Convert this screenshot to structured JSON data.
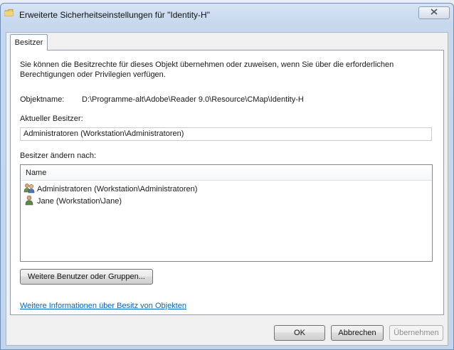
{
  "window": {
    "title": "Erweiterte Sicherheitseinstellungen für \"Identity-H\"",
    "icon": "folder-icon"
  },
  "tabs": [
    {
      "label": "Besitzer",
      "selected": true
    }
  ],
  "panel": {
    "intro_text": "Sie können die Besitzrechte für dieses Objekt übernehmen oder zuweisen, wenn Sie über die erforderlichen Berechtigungen oder Privilegien verfügen.",
    "object_name_label": "Objektname:",
    "object_name_value": "D:\\Programme-alt\\Adobe\\Reader 9.0\\Resource\\CMap\\Identity-H",
    "current_owner_label": "Aktueller Besitzer:",
    "current_owner_value": "Administratoren (Workstation\\Administratoren)",
    "change_owner_label": "Besitzer ändern nach:",
    "list": {
      "column_header": "Name",
      "items": [
        {
          "label": "Administratoren (Workstation\\Administratoren)",
          "icon": "group-icon"
        },
        {
          "label": "Jane (Workstation\\Jane)",
          "icon": "user-icon"
        }
      ]
    },
    "more_button": "Weitere Benutzer oder Gruppen...",
    "info_link": "Weitere Informationen über Besitz von Objekten"
  },
  "buttons": {
    "ok": "OK",
    "cancel": "Abbrechen",
    "apply": "Übernehmen",
    "apply_enabled": false
  },
  "colors": {
    "link": "#0066cc",
    "titlebar": "#c6d8ee"
  }
}
